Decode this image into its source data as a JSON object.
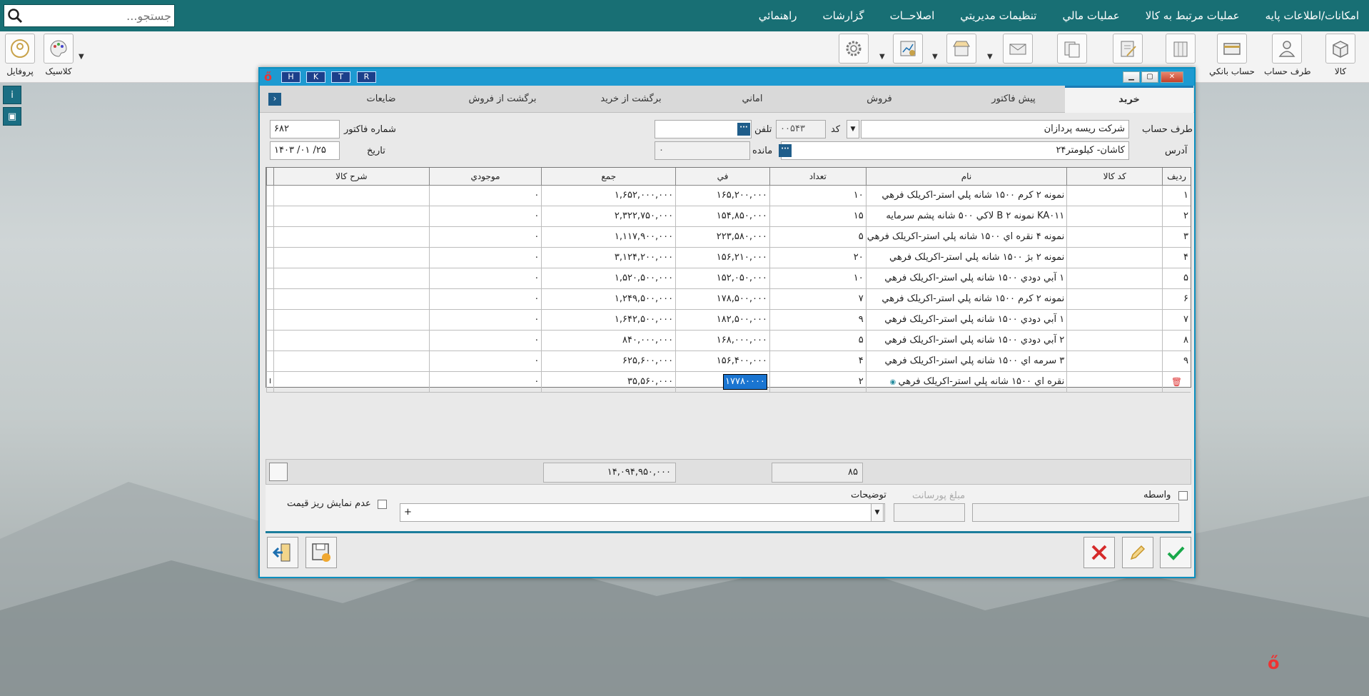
{
  "menu": [
    "امکانات/اطلاعات پايه",
    "عمليات مرتبط به کالا",
    "عمليات مالي",
    "تنظيمات مديريتي",
    "اصلاحــات",
    "گزارشات",
    "راهنمائي"
  ],
  "search": {
    "placeholder": "جستجو..."
  },
  "toolbar": {
    "items": [
      "کالا",
      "طرف حساب",
      "حساب بانکي"
    ],
    "profile": "پروفايل",
    "classic": "کلاسيک"
  },
  "window": {
    "buttons": [
      "R",
      "T",
      "K",
      "H"
    ]
  },
  "tabs": [
    "خريد",
    "پيش فاکتور",
    "فروش",
    "اماني",
    "برگشت از خريد",
    "برگشت از فروش",
    "ضايعات"
  ],
  "header": {
    "account_label": "طرف حساب",
    "account_value": "شرکت ريسه پردازان",
    "code_label": "کد",
    "code_value": "۰۰۵۴۳",
    "phone_label": "تلفن",
    "phone_value": "",
    "address_label": "آدرس",
    "address_value": "کاشان- کيلومتر۲۴",
    "balance_label": "مانده",
    "balance_value": "۰",
    "invoice_label": "شماره فاکتور",
    "invoice_value": "۶۸۲",
    "date_label": "تاريخ",
    "date_value": "۱۴۰۳ /۰۱ /۲۵"
  },
  "grid": {
    "columns": [
      "رديف",
      "کد کالا",
      "نام",
      "تعداد",
      "في",
      "جمع",
      "موجودي",
      "شرح کالا"
    ],
    "rows": [
      {
        "n": "۱",
        "code": "",
        "name": "نمونه ۲ کرم ۱۵۰۰ شانه پلي استر-اکريلک فرهي",
        "qty": "۱۰",
        "price": "۱۶۵,۲۰۰,۰۰۰",
        "total": "۱,۶۵۲,۰۰۰,۰۰۰",
        "stock": "۰",
        "desc": ""
      },
      {
        "n": "۲",
        "code": "",
        "name": "KA۰۱۱ نمونه ۲ B لاکي ۵۰۰ شانه پشم سرمايه",
        "qty": "۱۵",
        "price": "۱۵۴,۸۵۰,۰۰۰",
        "total": "۲,۳۲۲,۷۵۰,۰۰۰",
        "stock": "۰",
        "desc": ""
      },
      {
        "n": "۳",
        "code": "",
        "name": "نمونه ۴ نقره اي ۱۵۰۰ شانه پلي استر-اکريلک فرهي",
        "qty": "۵",
        "price": "۲۲۳,۵۸۰,۰۰۰",
        "total": "۱,۱۱۷,۹۰۰,۰۰۰",
        "stock": "۰",
        "desc": ""
      },
      {
        "n": "۴",
        "code": "",
        "name": "نمونه ۲ بژ ۱۵۰۰ شانه پلي استر-اکريلک فرهي",
        "qty": "۲۰",
        "price": "۱۵۶,۲۱۰,۰۰۰",
        "total": "۳,۱۲۴,۲۰۰,۰۰۰",
        "stock": "۰",
        "desc": ""
      },
      {
        "n": "۵",
        "code": "",
        "name": "۱ آبي دودي ۱۵۰۰ شانه پلي استر-اکريلک فرهي",
        "qty": "۱۰",
        "price": "۱۵۲,۰۵۰,۰۰۰",
        "total": "۱,۵۲۰,۵۰۰,۰۰۰",
        "stock": "۰",
        "desc": ""
      },
      {
        "n": "۶",
        "code": "",
        "name": "نمونه ۲ کرم ۱۵۰۰ شانه پلي استر-اکريلک فرهي",
        "qty": "۷",
        "price": "۱۷۸,۵۰۰,۰۰۰",
        "total": "۱,۲۴۹,۵۰۰,۰۰۰",
        "stock": "۰",
        "desc": ""
      },
      {
        "n": "۷",
        "code": "",
        "name": "۱ آبي دودي ۱۵۰۰ شانه پلي استر-اکريلک فرهي",
        "qty": "۹",
        "price": "۱۸۲,۵۰۰,۰۰۰",
        "total": "۱,۶۴۲,۵۰۰,۰۰۰",
        "stock": "۰",
        "desc": ""
      },
      {
        "n": "۸",
        "code": "",
        "name": "۲ آبي دودي ۱۵۰۰ شانه پلي استر-اکريلک فرهي",
        "qty": "۵",
        "price": "۱۶۸,۰۰۰,۰۰۰",
        "total": "۸۴۰,۰۰۰,۰۰۰",
        "stock": "۰",
        "desc": ""
      },
      {
        "n": "۹",
        "code": "",
        "name": "۳ سرمه اي ۱۵۰۰ شانه پلي استر-اکريلک فرهي",
        "qty": "۴",
        "price": "۱۵۶,۴۰۰,۰۰۰",
        "total": "۶۲۵,۶۰۰,۰۰۰",
        "stock": "۰",
        "desc": ""
      },
      {
        "n": "",
        "code": "",
        "name": "نقره اي ۱۵۰۰ شانه پلي استر-اکريلک فرهي",
        "qty": "۲",
        "price": "۱۷۷۸۰۰۰۰",
        "total": "۳۵,۵۶۰,۰۰۰",
        "stock": "۰",
        "desc": ""
      }
    ]
  },
  "totals": {
    "qty": "۸۵",
    "sum": "۱۴,۰۹۴,۹۵۰,۰۰۰"
  },
  "footer": {
    "broker_label": "واسطه",
    "commission_label": "مبلغ پورسانت",
    "notes_label": "توضيحات",
    "notes_value": "+",
    "hide_label": "عدم نمايش ريز قيمت"
  },
  "colors": {
    "topbar": "#186f74",
    "window_border": "#0b8fbf",
    "selection": "#1a75d1"
  }
}
